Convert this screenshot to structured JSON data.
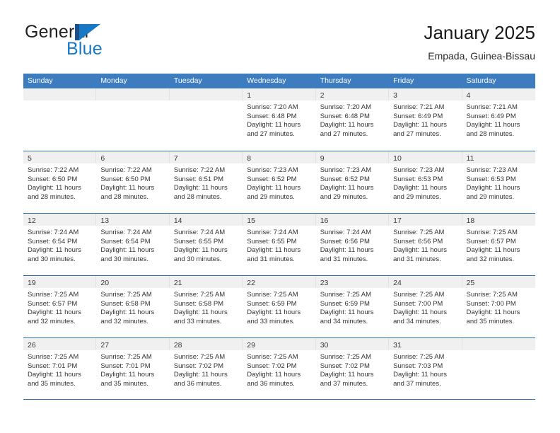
{
  "brand": {
    "name_top": "General",
    "name_bottom": "Blue",
    "mark": "triangle-logo",
    "color_dark": "#1b4f8a",
    "color_blue": "#1878c4"
  },
  "header": {
    "title": "January 2025",
    "subtitle": "Empada, Guinea-Bissau"
  },
  "theme": {
    "header_blue": "#3c7cbf",
    "rule_blue": "#2f6fb2",
    "daynum_band": "#f0f0f0"
  },
  "weekdays": [
    "Sunday",
    "Monday",
    "Tuesday",
    "Wednesday",
    "Thursday",
    "Friday",
    "Saturday"
  ],
  "weeks": [
    [
      {
        "day": "",
        "lines": []
      },
      {
        "day": "",
        "lines": []
      },
      {
        "day": "",
        "lines": []
      },
      {
        "day": "1",
        "lines": [
          "Sunrise: 7:20 AM",
          "Sunset: 6:48 PM",
          "Daylight: 11 hours",
          "and 27 minutes."
        ]
      },
      {
        "day": "2",
        "lines": [
          "Sunrise: 7:20 AM",
          "Sunset: 6:48 PM",
          "Daylight: 11 hours",
          "and 27 minutes."
        ]
      },
      {
        "day": "3",
        "lines": [
          "Sunrise: 7:21 AM",
          "Sunset: 6:49 PM",
          "Daylight: 11 hours",
          "and 27 minutes."
        ]
      },
      {
        "day": "4",
        "lines": [
          "Sunrise: 7:21 AM",
          "Sunset: 6:49 PM",
          "Daylight: 11 hours",
          "and 28 minutes."
        ]
      }
    ],
    [
      {
        "day": "5",
        "lines": [
          "Sunrise: 7:22 AM",
          "Sunset: 6:50 PM",
          "Daylight: 11 hours",
          "and 28 minutes."
        ]
      },
      {
        "day": "6",
        "lines": [
          "Sunrise: 7:22 AM",
          "Sunset: 6:50 PM",
          "Daylight: 11 hours",
          "and 28 minutes."
        ]
      },
      {
        "day": "7",
        "lines": [
          "Sunrise: 7:22 AM",
          "Sunset: 6:51 PM",
          "Daylight: 11 hours",
          "and 28 minutes."
        ]
      },
      {
        "day": "8",
        "lines": [
          "Sunrise: 7:23 AM",
          "Sunset: 6:52 PM",
          "Daylight: 11 hours",
          "and 29 minutes."
        ]
      },
      {
        "day": "9",
        "lines": [
          "Sunrise: 7:23 AM",
          "Sunset: 6:52 PM",
          "Daylight: 11 hours",
          "and 29 minutes."
        ]
      },
      {
        "day": "10",
        "lines": [
          "Sunrise: 7:23 AM",
          "Sunset: 6:53 PM",
          "Daylight: 11 hours",
          "and 29 minutes."
        ]
      },
      {
        "day": "11",
        "lines": [
          "Sunrise: 7:23 AM",
          "Sunset: 6:53 PM",
          "Daylight: 11 hours",
          "and 29 minutes."
        ]
      }
    ],
    [
      {
        "day": "12",
        "lines": [
          "Sunrise: 7:24 AM",
          "Sunset: 6:54 PM",
          "Daylight: 11 hours",
          "and 30 minutes."
        ]
      },
      {
        "day": "13",
        "lines": [
          "Sunrise: 7:24 AM",
          "Sunset: 6:54 PM",
          "Daylight: 11 hours",
          "and 30 minutes."
        ]
      },
      {
        "day": "14",
        "lines": [
          "Sunrise: 7:24 AM",
          "Sunset: 6:55 PM",
          "Daylight: 11 hours",
          "and 30 minutes."
        ]
      },
      {
        "day": "15",
        "lines": [
          "Sunrise: 7:24 AM",
          "Sunset: 6:55 PM",
          "Daylight: 11 hours",
          "and 31 minutes."
        ]
      },
      {
        "day": "16",
        "lines": [
          "Sunrise: 7:24 AM",
          "Sunset: 6:56 PM",
          "Daylight: 11 hours",
          "and 31 minutes."
        ]
      },
      {
        "day": "17",
        "lines": [
          "Sunrise: 7:25 AM",
          "Sunset: 6:56 PM",
          "Daylight: 11 hours",
          "and 31 minutes."
        ]
      },
      {
        "day": "18",
        "lines": [
          "Sunrise: 7:25 AM",
          "Sunset: 6:57 PM",
          "Daylight: 11 hours",
          "and 32 minutes."
        ]
      }
    ],
    [
      {
        "day": "19",
        "lines": [
          "Sunrise: 7:25 AM",
          "Sunset: 6:57 PM",
          "Daylight: 11 hours",
          "and 32 minutes."
        ]
      },
      {
        "day": "20",
        "lines": [
          "Sunrise: 7:25 AM",
          "Sunset: 6:58 PM",
          "Daylight: 11 hours",
          "and 32 minutes."
        ]
      },
      {
        "day": "21",
        "lines": [
          "Sunrise: 7:25 AM",
          "Sunset: 6:58 PM",
          "Daylight: 11 hours",
          "and 33 minutes."
        ]
      },
      {
        "day": "22",
        "lines": [
          "Sunrise: 7:25 AM",
          "Sunset: 6:59 PM",
          "Daylight: 11 hours",
          "and 33 minutes."
        ]
      },
      {
        "day": "23",
        "lines": [
          "Sunrise: 7:25 AM",
          "Sunset: 6:59 PM",
          "Daylight: 11 hours",
          "and 34 minutes."
        ]
      },
      {
        "day": "24",
        "lines": [
          "Sunrise: 7:25 AM",
          "Sunset: 7:00 PM",
          "Daylight: 11 hours",
          "and 34 minutes."
        ]
      },
      {
        "day": "25",
        "lines": [
          "Sunrise: 7:25 AM",
          "Sunset: 7:00 PM",
          "Daylight: 11 hours",
          "and 35 minutes."
        ]
      }
    ],
    [
      {
        "day": "26",
        "lines": [
          "Sunrise: 7:25 AM",
          "Sunset: 7:01 PM",
          "Daylight: 11 hours",
          "and 35 minutes."
        ]
      },
      {
        "day": "27",
        "lines": [
          "Sunrise: 7:25 AM",
          "Sunset: 7:01 PM",
          "Daylight: 11 hours",
          "and 35 minutes."
        ]
      },
      {
        "day": "28",
        "lines": [
          "Sunrise: 7:25 AM",
          "Sunset: 7:02 PM",
          "Daylight: 11 hours",
          "and 36 minutes."
        ]
      },
      {
        "day": "29",
        "lines": [
          "Sunrise: 7:25 AM",
          "Sunset: 7:02 PM",
          "Daylight: 11 hours",
          "and 36 minutes."
        ]
      },
      {
        "day": "30",
        "lines": [
          "Sunrise: 7:25 AM",
          "Sunset: 7:02 PM",
          "Daylight: 11 hours",
          "and 37 minutes."
        ]
      },
      {
        "day": "31",
        "lines": [
          "Sunrise: 7:25 AM",
          "Sunset: 7:03 PM",
          "Daylight: 11 hours",
          "and 37 minutes."
        ]
      },
      {
        "day": "",
        "lines": []
      }
    ]
  ]
}
